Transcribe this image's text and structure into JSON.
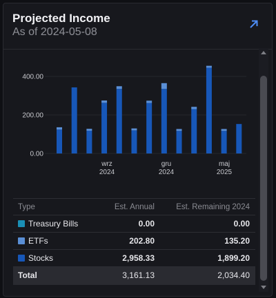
{
  "header": {
    "title": "Projected Income",
    "subtitle": "As of 2024-05-08",
    "open_icon": "arrow-up-right-icon"
  },
  "colors": {
    "treasury": "#1a8fb5",
    "etfs": "#5a8fd6",
    "stocks": "#1757b8",
    "accent": "#4d8cf5"
  },
  "chart_data": {
    "type": "bar",
    "stacked": true,
    "ylim": [
      0,
      460
    ],
    "yticks": [
      "0.00",
      "200.00",
      "400.00"
    ],
    "ytick_values": [
      0,
      200,
      400
    ],
    "grid": true,
    "x_labels": [
      {
        "index": 6,
        "month": "wrz",
        "year": "2024"
      },
      {
        "index": 10,
        "month": "gru",
        "year": "2024"
      },
      {
        "index": 15,
        "month": "maj",
        "year": "2025"
      }
    ],
    "series": [
      {
        "name": "Stocks",
        "values": [
          124,
          343,
          118,
          263,
          335,
          120,
          262,
          335,
          117,
          230,
          445,
          117,
          153
        ]
      },
      {
        "name": "ETFs",
        "values": [
          12,
          0,
          10,
          12,
          14,
          10,
          12,
          30,
          10,
          12,
          10,
          10,
          0
        ]
      }
    ]
  },
  "table": {
    "headers": [
      "Type",
      "Est. Annual",
      "Est. Remaining 2024"
    ],
    "rows": [
      {
        "type": "Treasury Bills",
        "annual": "0.00",
        "remaining": "0.00",
        "swatch": "#1a8fb5"
      },
      {
        "type": "ETFs",
        "annual": "202.80",
        "remaining": "135.20",
        "swatch": "#5a8fd6"
      },
      {
        "type": "Stocks",
        "annual": "2,958.33",
        "remaining": "1,899.20",
        "swatch": "#1757b8"
      }
    ],
    "total": {
      "type": "Total",
      "annual": "3,161.13",
      "remaining": "2,034.40"
    }
  }
}
